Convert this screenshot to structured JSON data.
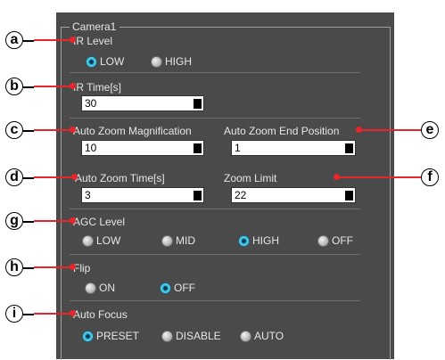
{
  "section": {
    "title": "Camera1"
  },
  "ir_level": {
    "label": "IR Level",
    "options": [
      "LOW",
      "HIGH"
    ],
    "selected": "LOW"
  },
  "ir_time": {
    "label": "IR Time[s]",
    "value": "30"
  },
  "auto_zoom_magnification": {
    "label": "Auto Zoom Magnification",
    "value": "10"
  },
  "auto_zoom_end_position": {
    "label": "Auto Zoom End Position",
    "value": "1"
  },
  "auto_zoom_time": {
    "label": "Auto Zoom Time[s]",
    "value": "3"
  },
  "zoom_limit": {
    "label": "Zoom Limit",
    "value": "22"
  },
  "agc_level": {
    "label": "AGC Level",
    "options": [
      "LOW",
      "MID",
      "HIGH",
      "OFF"
    ],
    "selected": "HIGH"
  },
  "flip": {
    "label": "Flip",
    "options": [
      "ON",
      "OFF"
    ],
    "selected": "OFF"
  },
  "auto_focus": {
    "label": "Auto Focus",
    "options": [
      "PRESET",
      "DISABLE",
      "AUTO"
    ],
    "selected": "PRESET"
  },
  "callouts": [
    "a",
    "b",
    "c",
    "d",
    "e",
    "f",
    "g",
    "h",
    "i"
  ],
  "colors": {
    "panel": "#4a4a4a",
    "leader": "#e8262a",
    "radio_selected": "#1da3c9"
  }
}
